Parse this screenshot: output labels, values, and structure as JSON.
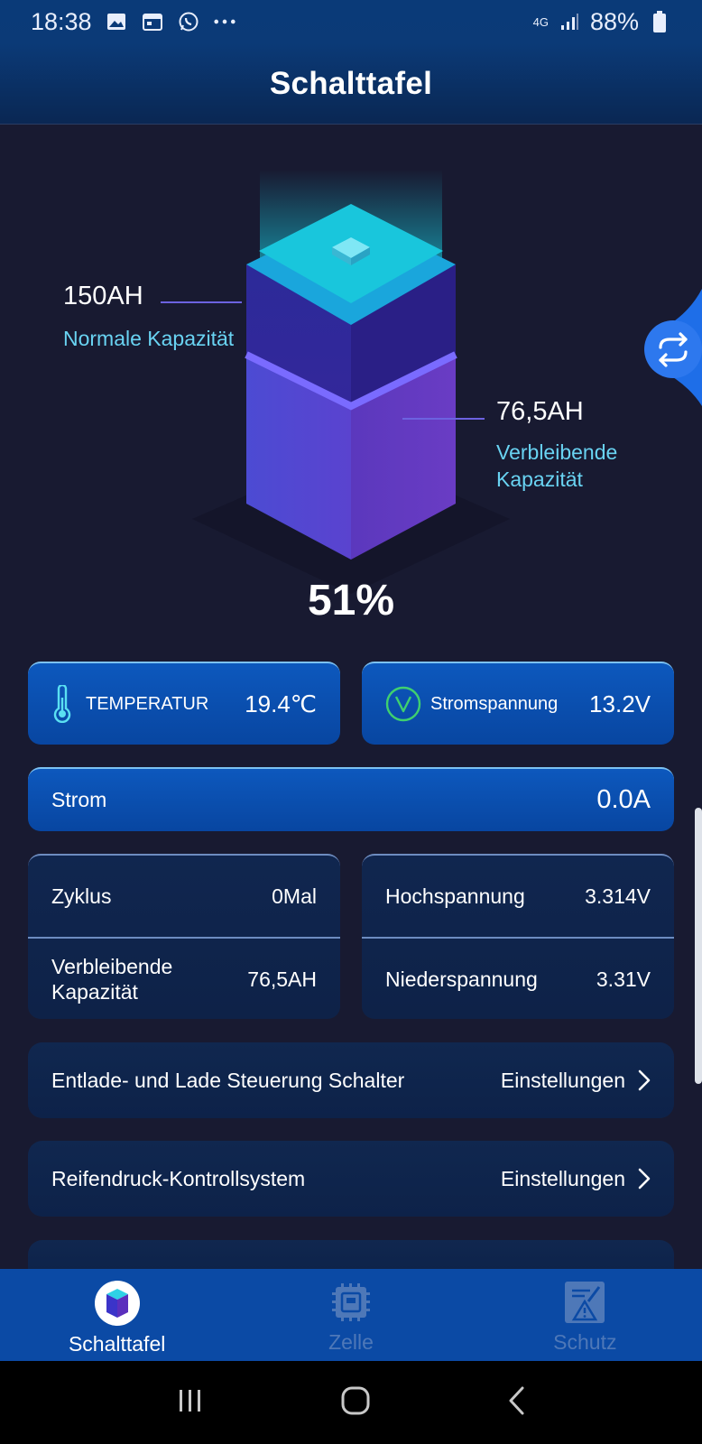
{
  "status_bar": {
    "time": "18:38",
    "network": "4G",
    "battery": "88%"
  },
  "header": {
    "title": "Schalttafel"
  },
  "hero": {
    "nominal_value": "150AH",
    "nominal_label": "Normale Kapazität",
    "remaining_value": "76,5AH",
    "remaining_label_line1": "Verbleibende",
    "remaining_label_line2": "Kapazität",
    "percent": "51%",
    "fill_fraction": 0.51
  },
  "tiles": {
    "temperature": {
      "label": "TEMPERATUR",
      "value": "19.4℃"
    },
    "voltage": {
      "label": "Stromspannung",
      "value": "13.2V"
    },
    "current": {
      "label": "Strom",
      "value": "0.0A"
    }
  },
  "stats_left": {
    "cycle_label": "Zyklus",
    "cycle_value": "0Mal",
    "remaining_label_line1": "Verbleibende",
    "remaining_label_line2": "Kapazität",
    "remaining_value": "76,5AH"
  },
  "stats_right": {
    "high_label": "Hochspannung",
    "high_value": "3.314V",
    "low_label": "Niederspannung",
    "low_value": "3.31V"
  },
  "settings": [
    {
      "label": "Entlade- und Lade Steuerung Schalter",
      "action": "Einstellungen"
    },
    {
      "label": "Reifendruck-Kontrollsystem",
      "action": "Einstellungen"
    }
  ],
  "tabbar": {
    "tabs": [
      {
        "label": "Schalttafel",
        "icon": "battery-cube-icon",
        "active": true
      },
      {
        "label": "Zelle",
        "icon": "chip-icon",
        "active": false
      },
      {
        "label": "Schutz",
        "icon": "warning-doc-icon",
        "active": false
      }
    ]
  },
  "colors": {
    "accent": "#0b4aa5",
    "label_cyan": "#69d3f2",
    "background": "#181a31"
  }
}
